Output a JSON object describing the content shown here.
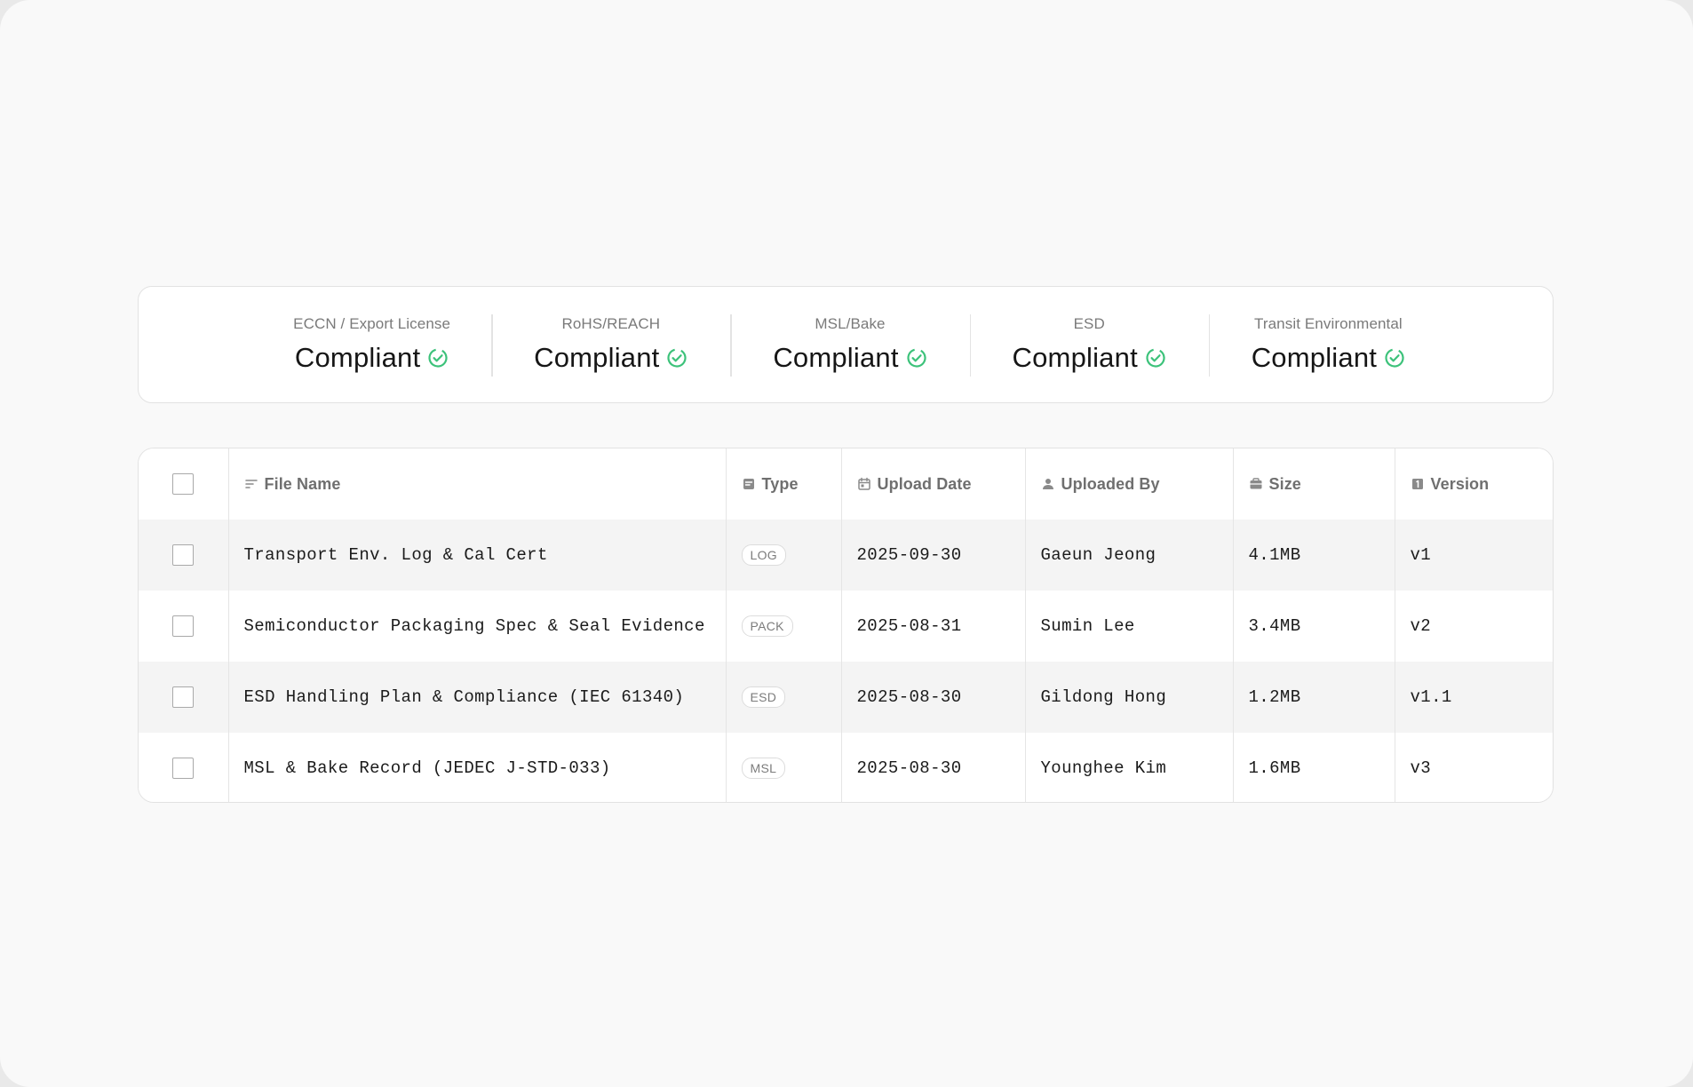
{
  "summary": [
    {
      "label": "ECCN / Export License",
      "value": "Compliant",
      "icon": "check-circle-icon"
    },
    {
      "label": "RoHS/REACH",
      "value": "Compliant",
      "icon": "check-circle-icon"
    },
    {
      "label": "MSL/Bake",
      "value": "Compliant",
      "icon": "check-circle-icon"
    },
    {
      "label": "ESD",
      "value": "Compliant",
      "icon": "check-circle-icon"
    },
    {
      "label": "Transit Environmental",
      "value": "Compliant",
      "icon": "check-circle-icon"
    }
  ],
  "colors": {
    "accent_green": "#3cc27a"
  },
  "table": {
    "headers": {
      "file_name": "File Name",
      "type": "Type",
      "upload_date": "Upload Date",
      "uploaded_by": "Uploaded By",
      "size": "Size",
      "version": "Version"
    },
    "rows": [
      {
        "file_name": "Transport Env. Log & Cal Cert",
        "type": "LOG",
        "upload_date": "2025-09-30",
        "uploaded_by": "Gaeun Jeong",
        "size": "4.1MB",
        "version": "v1"
      },
      {
        "file_name": "Semiconductor Packaging Spec & Seal Evidence",
        "type": "PACK",
        "upload_date": "2025-08-31",
        "uploaded_by": "Sumin Lee",
        "size": "3.4MB",
        "version": "v2"
      },
      {
        "file_name": "ESD Handling Plan & Compliance (IEC 61340)",
        "type": "ESD",
        "upload_date": "2025-08-30",
        "uploaded_by": "Gildong Hong",
        "size": "1.2MB",
        "version": "v1.1"
      },
      {
        "file_name": "MSL & Bake Record (JEDEC J-STD-033)",
        "type": "MSL",
        "upload_date": "2025-08-30",
        "uploaded_by": "Younghee Kim",
        "size": "1.6MB",
        "version": "v3"
      }
    ]
  }
}
